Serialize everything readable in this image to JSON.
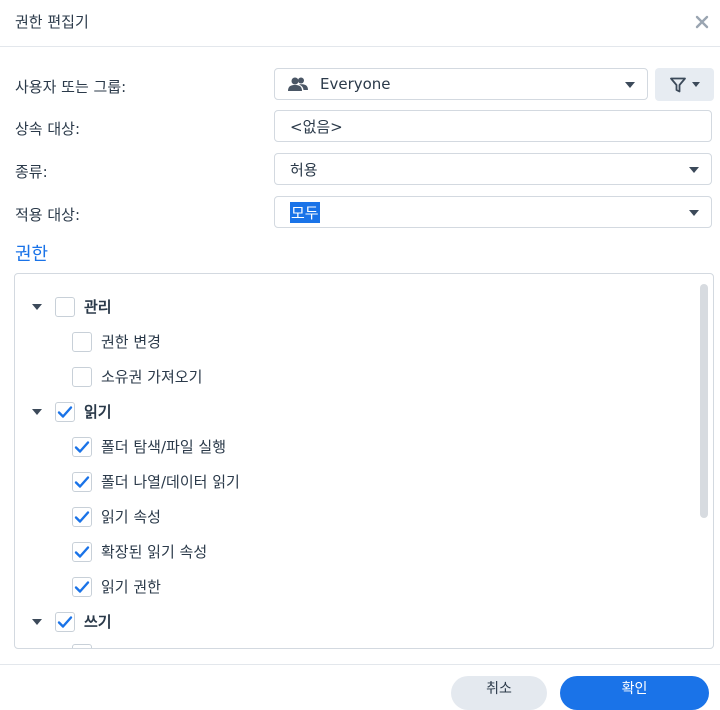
{
  "dialog": {
    "title": "권한 편집기"
  },
  "form": {
    "user_label": "사용자 또는 그룹:",
    "user_value": "Everyone",
    "inherit_label": "상속 대상:",
    "inherit_value": "<없음>",
    "type_label": "종류:",
    "type_value": "허용",
    "apply_label": "적용 대상:",
    "apply_value": "모두"
  },
  "permissions": {
    "title": "권한",
    "groups": [
      {
        "label": "관리",
        "checked": false,
        "items": [
          {
            "label": "권한 변경",
            "checked": false
          },
          {
            "label": "소유권 가져오기",
            "checked": false
          }
        ]
      },
      {
        "label": "읽기",
        "checked": true,
        "items": [
          {
            "label": "폴더 탐색/파일 실행",
            "checked": true
          },
          {
            "label": "폴더 나열/데이터 읽기",
            "checked": true
          },
          {
            "label": "읽기 속성",
            "checked": true
          },
          {
            "label": "확장된 읽기 속성",
            "checked": true
          },
          {
            "label": "읽기 권한",
            "checked": true
          }
        ]
      },
      {
        "label": "쓰기",
        "checked": true,
        "items": []
      }
    ]
  },
  "footer": {
    "cancel_label": "취소",
    "ok_label": "확인"
  },
  "colors": {
    "accent": "#1a73e8",
    "check": "#1a73e8"
  }
}
